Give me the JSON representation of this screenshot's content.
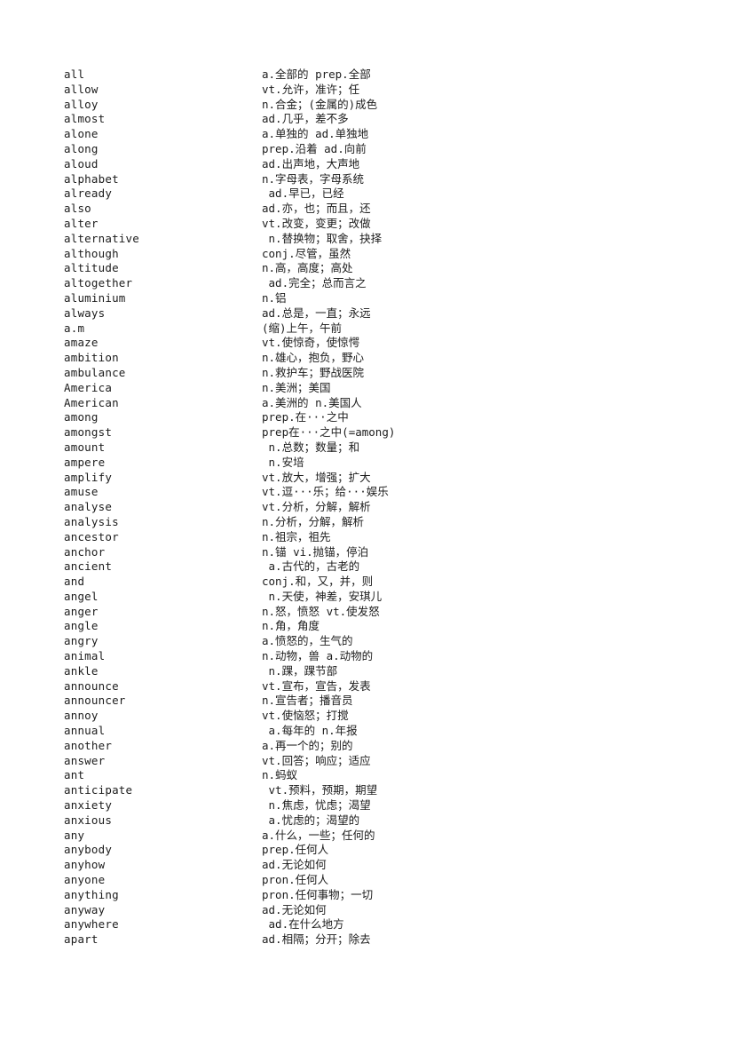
{
  "page": {
    "background_color": "#ffffff",
    "text_color": "#1c1c1c",
    "document_type": "vocabulary-word-list",
    "columns": [
      "word",
      "definition"
    ]
  },
  "entries": [
    {
      "word": "all",
      "definition": "a.全部的 prep.全部"
    },
    {
      "word": "allow",
      "definition": "vt.允许，准许；任"
    },
    {
      "word": "alloy",
      "definition": "n.合金；(金属的)成色"
    },
    {
      "word": "almost",
      "definition": "ad.几乎，差不多"
    },
    {
      "word": "alone",
      "definition": "a.单独的 ad.单独地"
    },
    {
      "word": "along",
      "definition": "prep.沿着 ad.向前"
    },
    {
      "word": "aloud",
      "definition": "ad.出声地，大声地"
    },
    {
      "word": "alphabet",
      "definition": "n.字母表，字母系统"
    },
    {
      "word": "already",
      "definition": " ad.早已，已经"
    },
    {
      "word": "also",
      "definition": "ad.亦，也；而且，还"
    },
    {
      "word": "alter",
      "definition": "vt.改变，变更；改做"
    },
    {
      "word": "alternative",
      "definition": " n.替换物；取舍，抉择"
    },
    {
      "word": "although",
      "definition": "conj.尽管，虽然"
    },
    {
      "word": "altitude",
      "definition": "n.高，高度；高处"
    },
    {
      "word": "altogether",
      "definition": " ad.完全；总而言之"
    },
    {
      "word": "aluminium",
      "definition": "n.铝"
    },
    {
      "word": "always",
      "definition": "ad.总是，一直；永远"
    },
    {
      "word": "a.m",
      "definition": "(缩)上午，午前"
    },
    {
      "word": "amaze",
      "definition": "vt.使惊奇，使惊愕"
    },
    {
      "word": "ambition",
      "definition": "n.雄心，抱负，野心"
    },
    {
      "word": "ambulance",
      "definition": "n.救护车；野战医院"
    },
    {
      "word": "America",
      "definition": "n.美洲；美国"
    },
    {
      "word": "American",
      "definition": "a.美洲的 n.美国人"
    },
    {
      "word": "among",
      "definition": "prep.在···之中"
    },
    {
      "word": "amongst",
      "definition": "prep在···之中(=among)"
    },
    {
      "word": "amount",
      "definition": " n.总数；数量；和"
    },
    {
      "word": "ampere",
      "definition": " n.安培"
    },
    {
      "word": "amplify",
      "definition": "vt.放大，增强；扩大"
    },
    {
      "word": "amuse",
      "definition": "vt.逗···乐；给···娱乐"
    },
    {
      "word": "analyse",
      "definition": "vt.分析，分解，解析"
    },
    {
      "word": "analysis",
      "definition": "n.分析，分解，解析"
    },
    {
      "word": "ancestor",
      "definition": "n.祖宗，祖先"
    },
    {
      "word": "anchor",
      "definition": "n.锚 vi.抛锚，停泊"
    },
    {
      "word": "ancient",
      "definition": " a.古代的，古老的"
    },
    {
      "word": "and",
      "definition": "conj.和，又，并，则"
    },
    {
      "word": "angel",
      "definition": " n.天使，神差，安琪儿"
    },
    {
      "word": "anger",
      "definition": "n.怒，愤怒 vt.使发怒"
    },
    {
      "word": "angle",
      "definition": "n.角，角度"
    },
    {
      "word": "angry",
      "definition": "a.愤怒的，生气的"
    },
    {
      "word": "animal",
      "definition": "n.动物，兽 a.动物的"
    },
    {
      "word": "ankle",
      "definition": " n.踝，踝节部"
    },
    {
      "word": "announce",
      "definition": "vt.宣布，宣告，发表"
    },
    {
      "word": "announcer",
      "definition": "n.宣告者；播音员"
    },
    {
      "word": "annoy",
      "definition": "vt.使恼怒；打搅"
    },
    {
      "word": "annual",
      "definition": " a.每年的 n.年报"
    },
    {
      "word": "another",
      "definition": "a.再一个的；别的"
    },
    {
      "word": "answer",
      "definition": "vt.回答；响应；适应"
    },
    {
      "word": "ant",
      "definition": "n.蚂蚁"
    },
    {
      "word": "anticipate",
      "definition": " vt.预料，预期，期望"
    },
    {
      "word": "anxiety",
      "definition": " n.焦虑，忧虑；渴望"
    },
    {
      "word": "anxious",
      "definition": " a.忧虑的；渴望的"
    },
    {
      "word": "any",
      "definition": "a.什么，一些；任何的"
    },
    {
      "word": "anybody",
      "definition": "prep.任何人"
    },
    {
      "word": "anyhow",
      "definition": "ad.无论如何"
    },
    {
      "word": "anyone",
      "definition": "pron.任何人"
    },
    {
      "word": "anything",
      "definition": "pron.任何事物；一切"
    },
    {
      "word": "anyway",
      "definition": "ad.无论如何"
    },
    {
      "word": "anywhere",
      "definition": " ad.在什么地方"
    },
    {
      "word": "apart",
      "definition": "ad.相隔；分开；除去"
    }
  ]
}
